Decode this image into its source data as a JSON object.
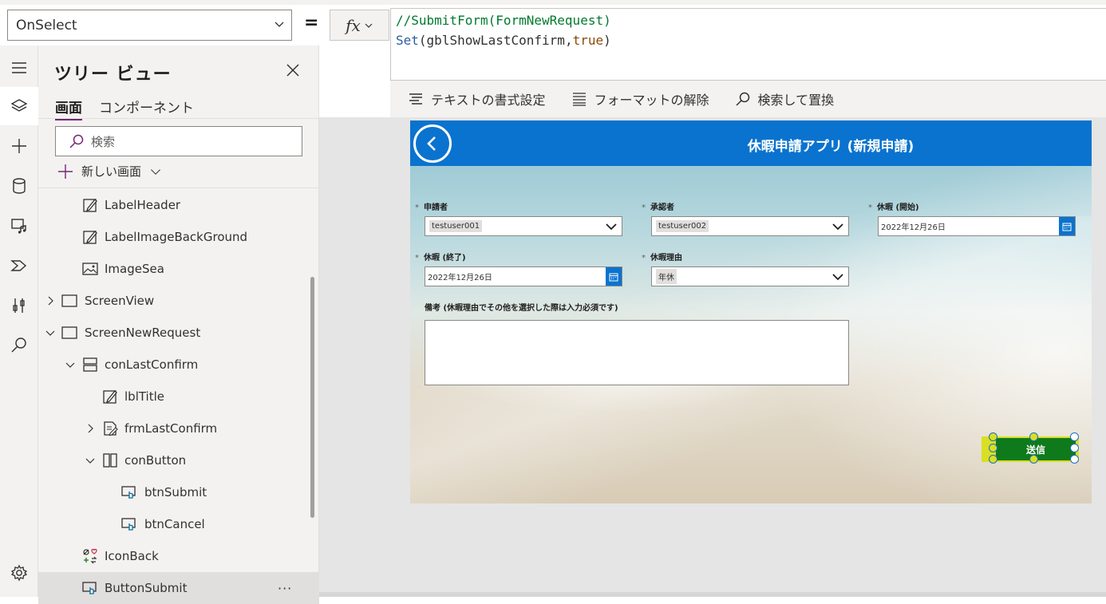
{
  "formula_bar": {
    "property": "OnSelect",
    "equals": "=",
    "fx": "fx",
    "line1": "//SubmitForm(FormNewRequest)",
    "line2_fn": "Set",
    "line2_open": "(",
    "line2_arg": "gblShowLastConfirm",
    "line2_comma": ",",
    "line2_kw": "true",
    "line2_close": ")"
  },
  "format_bar": {
    "format_text": "テキストの書式設定",
    "remove_format": "フォーマットの解除",
    "find_replace": "検索して置換"
  },
  "tree": {
    "title": "ツリー ビュー",
    "tab_screens": "画面",
    "tab_components": "コンポーネント",
    "search_placeholder": "検索",
    "new_screen": "新しい画面",
    "nodes": [
      {
        "label": "LabelHeader"
      },
      {
        "label": "LabelImageBackGround"
      },
      {
        "label": "ImageSea"
      },
      {
        "label": "ScreenView"
      },
      {
        "label": "ScreenNewRequest"
      },
      {
        "label": "conLastConfirm"
      },
      {
        "label": "lblTitle"
      },
      {
        "label": "frmLastConfirm"
      },
      {
        "label": "conButton"
      },
      {
        "label": "btnSubmit"
      },
      {
        "label": "btnCancel"
      },
      {
        "label": "IconBack"
      },
      {
        "label": "ButtonSubmit"
      }
    ],
    "more": "···"
  },
  "app": {
    "title": "休暇申請アプリ (新規申請)",
    "required_mark": "*",
    "fields": {
      "applicant_label": "申請者",
      "applicant_value": "testuser001",
      "approver_label": "承認者",
      "approver_value": "testuser002",
      "start_label": "休暇 (開始)",
      "start_value": "2022年12月26日",
      "end_label": "休暇 (終了)",
      "end_value": "2022年12月26日",
      "reason_label": "休暇理由",
      "reason_value": "年休",
      "notes_label": "備考 (休暇理由でその他を選択した際は入力必須です)"
    },
    "submit_label": "送信"
  },
  "colors": {
    "header_blue": "#0a73cf",
    "submit_green": "#0e7a1c",
    "selection_yellow": "#d9df23",
    "tab_underline": "#742774"
  }
}
